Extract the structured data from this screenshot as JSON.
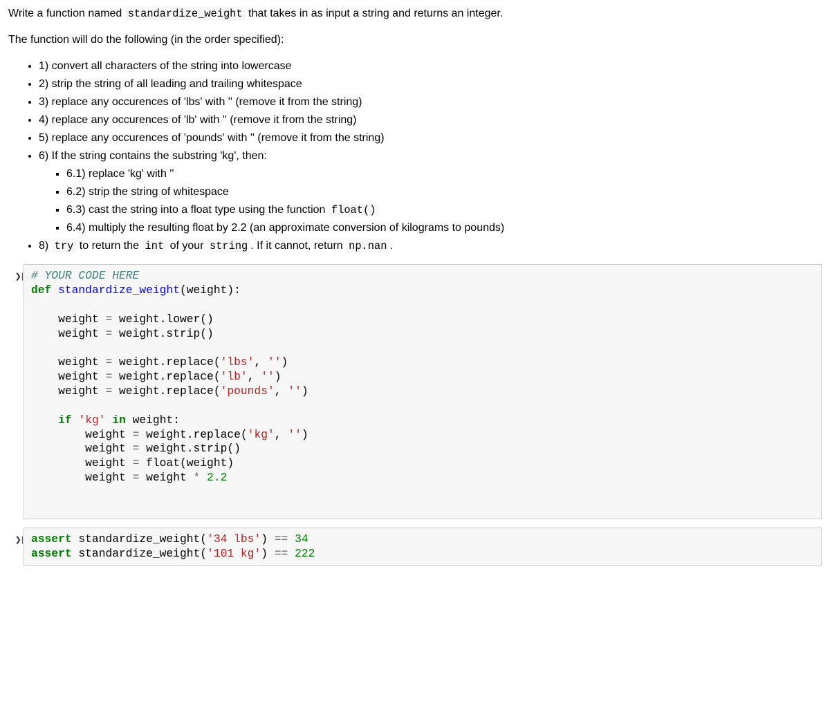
{
  "intro": {
    "p1_a": "Write a function named ",
    "p1_code": "standardize_weight",
    "p1_b": " that takes in as input a string and returns an integer.",
    "p2": "The function will do the following (in the order specified):"
  },
  "steps": {
    "s1": "1) convert all characters of the string into lowercase",
    "s2": "2) strip the string of all leading and trailing whitespace",
    "s3": "3) replace any occurences of 'lbs' with '' (remove it from the string)",
    "s4": "4) replace any occurences of 'lb' with '' (remove it from the string)",
    "s5": "5) replace any occurences of 'pounds' with '' (remove it from the string)",
    "s6": "6) If the string contains the substring 'kg', then:",
    "s6_1": "6.1) replace 'kg' with ''",
    "s6_2": "6.2) strip the string of whitespace",
    "s6_3a": "6.3) cast the string into a float type using the function ",
    "s6_3_code": "float()",
    "s6_4": "6.4) multiply the resulting float by 2.2 (an approximate conversion of kilograms to pounds)",
    "s8_a": "8) ",
    "s8_try": "try",
    "s8_b": " to return the ",
    "s8_int": "int",
    "s8_c": " of your ",
    "s8_string": "string",
    "s8_d": ". If it cannot, return ",
    "s8_npnan": "np.nan",
    "s8_e": "."
  },
  "code1": {
    "l1_comment": "# YOUR CODE HERE",
    "l2_def": "def",
    "l2_fn": "standardize_weight",
    "l2_paren": "(weight):",
    "l4": "    weight ",
    "eq": "=",
    "l4b": " weight.lower()",
    "l5b": " weight.strip()",
    "l7b": " weight.replace(",
    "str_lbs": "'lbs'",
    "comma_empty": ", ",
    "str_empty": "''",
    "rparen": ")",
    "str_lb": "'lb'",
    "str_pounds": "'pounds'",
    "if_kw": "if",
    "str_kg": "'kg'",
    "in_kw": "in",
    "in_weight": " weight:",
    "indent2": "        weight ",
    "float_call": " float(weight)",
    "mult": " weight ",
    "star": "*",
    "num22": " 2.2"
  },
  "code2": {
    "assert_kw": "assert",
    "call1a": " standardize_weight(",
    "str1": "'34 lbs'",
    "call1b": ") ",
    "eqeq": "==",
    "v1": " 34",
    "str2": "'101 kg'",
    "v2": " 222"
  }
}
